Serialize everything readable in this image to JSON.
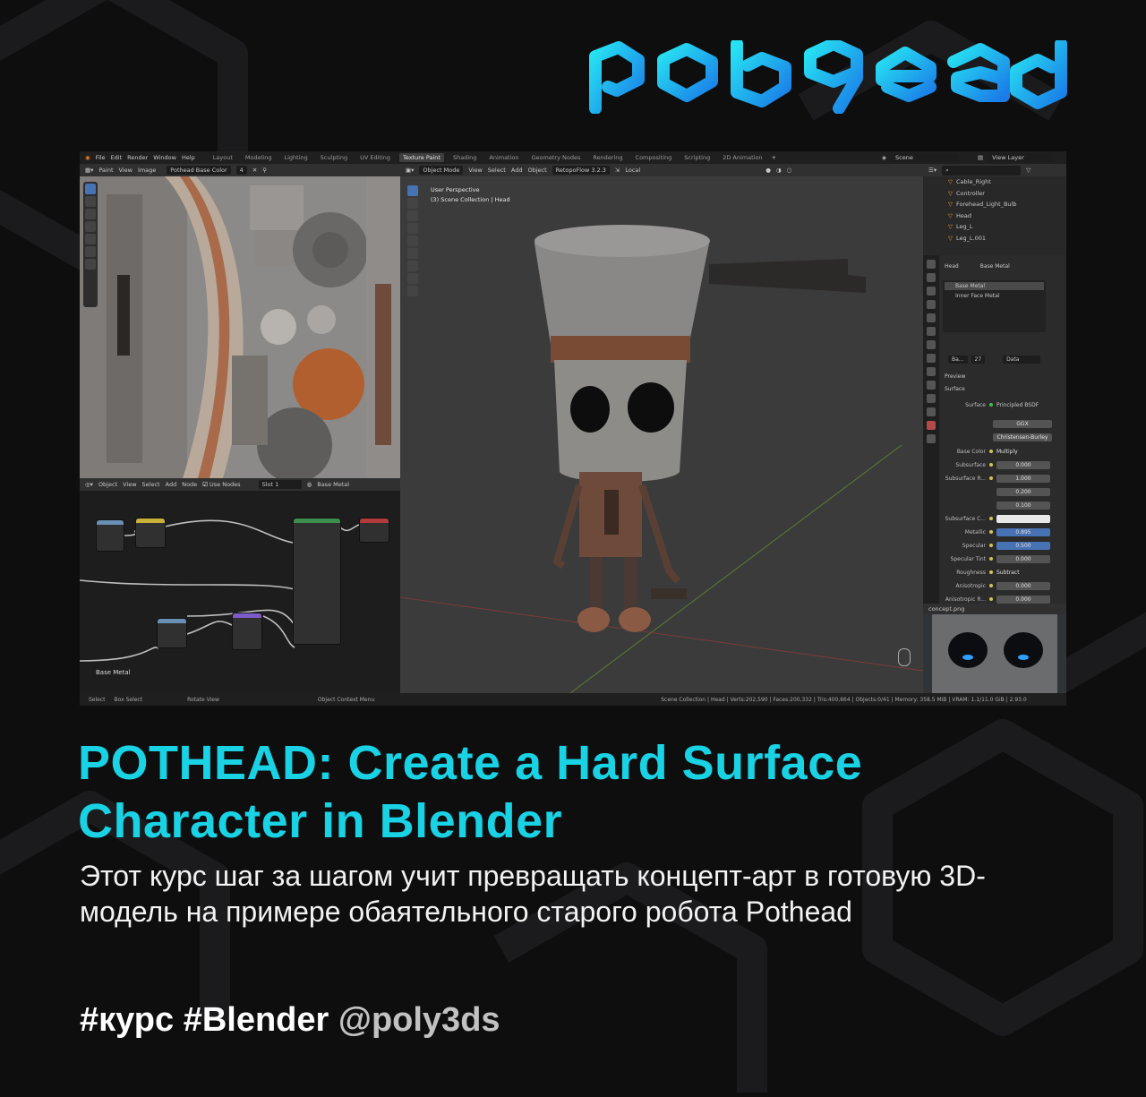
{
  "brand": {
    "logo_text": "polyhead",
    "accent": "#19d2e3"
  },
  "blender": {
    "menu": [
      "File",
      "Edit",
      "Render",
      "Window",
      "Help"
    ],
    "workspaces": [
      "Layout",
      "Modeling",
      "Lighting",
      "Sculpting",
      "UV Editing",
      "Texture Paint",
      "Shading",
      "Animation",
      "Geometry Nodes",
      "Rendering",
      "Compositing",
      "Scripting",
      "2D Animation"
    ],
    "active_workspace": "Texture Paint",
    "scene": "Scene",
    "view_layer": "View Layer",
    "image_editor": {
      "mode": "Paint",
      "view": "View",
      "image": "Image",
      "image_name": "Pothead Base Color",
      "users": "4"
    },
    "viewport": {
      "mode": "Object Mode",
      "view": "View",
      "select": "Select",
      "add": "Add",
      "object": "Object",
      "retopo": "RetopoFlow 3.2.3",
      "transform": "Local",
      "info_line1": "User Perspective",
      "info_line2": "(3) Scene Collection | Head"
    },
    "outliner": {
      "items": [
        "Cable_Right",
        "Controller",
        "Forehead_Light_Bulb",
        "Head",
        "Leg_L",
        "Leg_L.001"
      ]
    },
    "node_editor": {
      "object": "Object",
      "view": "View",
      "select": "Select",
      "add": "Add",
      "node": "Node",
      "use_nodes": "Use Nodes",
      "slot": "Slot 1",
      "material": "Base Metal",
      "frame_label": "Base Metal"
    },
    "properties": {
      "object": "Head",
      "material": "Base Metal",
      "slots": [
        "Base Metal",
        "Inner Face Metal"
      ],
      "mat_short": "Ba...",
      "mat_users": "27",
      "link": "Data",
      "preview": "Preview",
      "surface_panel": "Surface",
      "surface_label": "Surface",
      "surface_shader": "Principled BSDF",
      "distribution": "GGX",
      "subsurface_method": "Christensen-Burley",
      "rows": [
        {
          "label": "Base Color",
          "value": "Multiply",
          "style": "link"
        },
        {
          "label": "Subsurface",
          "value": "0.000",
          "style": "grey"
        },
        {
          "label": "Subsurface R...",
          "value": "1.000",
          "style": "grey"
        },
        {
          "label": "",
          "value": "0.200",
          "style": "grey"
        },
        {
          "label": "",
          "value": "0.100",
          "style": "grey"
        },
        {
          "label": "Subsurface C...",
          "value": "",
          "style": "white"
        },
        {
          "label": "Metallic",
          "value": "0.895",
          "style": "blue"
        },
        {
          "label": "Specular",
          "value": "0.500",
          "style": "blue"
        },
        {
          "label": "Specular Tint",
          "value": "0.000",
          "style": "grey"
        },
        {
          "label": "Roughness",
          "value": "Subtract",
          "style": "link"
        },
        {
          "label": "Anisotropic",
          "value": "0.000",
          "style": "grey"
        },
        {
          "label": "Anisotropic R...",
          "value": "0.000",
          "style": "grey"
        }
      ]
    },
    "thumb_file": "concept.png",
    "status": {
      "select": "Select",
      "box_select": "Box Select",
      "rotate": "Rotate View",
      "context": "Object Context Menu",
      "stats": "Scene Collection | Head | Verts:202,590 | Faces:200,332 | Tris:400,664 | Objects:0/41 | Memory: 358.5 MiB | VRAM: 1.1/11.0 GiB | 2.93.0"
    }
  },
  "post": {
    "title": "POTHEAD: Create a Hard Surface Character in Blender",
    "description": "Этот курс шаг за шагом учит превращать концепт-арт в готовую 3D-модель на примере обаятельного старого робота Pothead",
    "tag1": "#курс",
    "tag2": "#Blender",
    "handle": "@poly3ds"
  }
}
